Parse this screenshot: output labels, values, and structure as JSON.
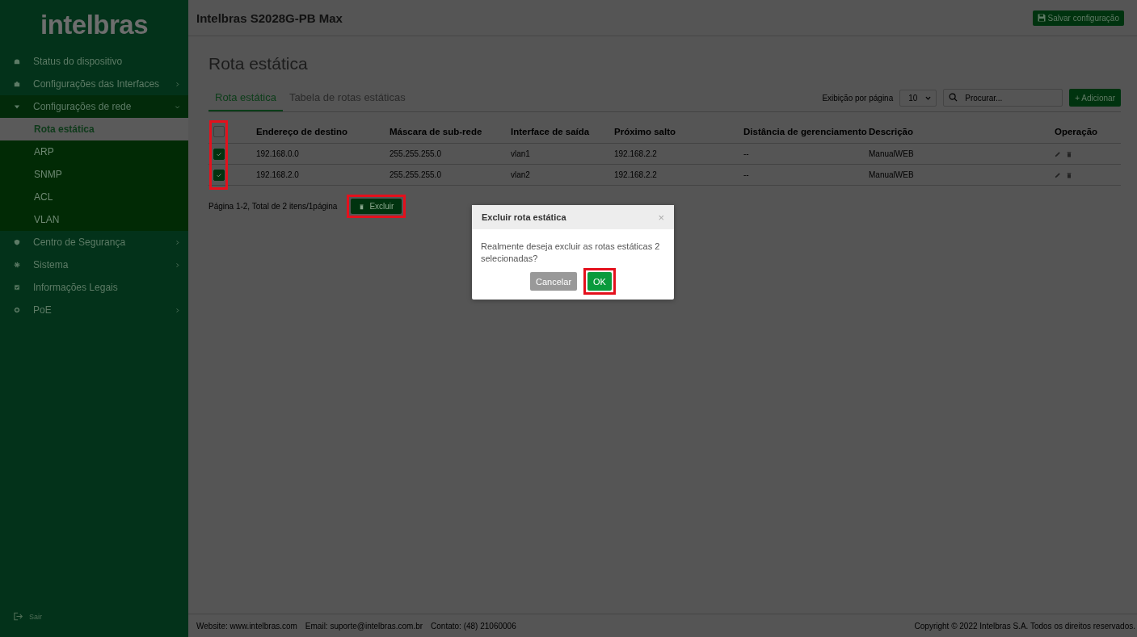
{
  "sidebar": {
    "logo": "intelbras",
    "items": [
      {
        "label": "Status do dispositivo",
        "kind": "home",
        "has_arrow": false,
        "expanded": false
      },
      {
        "label": "Configurações das Interfaces",
        "kind": "briefcase",
        "has_arrow": true,
        "expanded": false
      },
      {
        "label": "Configurações de rede",
        "kind": "caret",
        "has_arrow": true,
        "expanded": true,
        "children": [
          {
            "label": "Rota estática",
            "selected": true
          },
          {
            "label": "ARP",
            "selected": false
          },
          {
            "label": "SNMP",
            "selected": false
          },
          {
            "label": "ACL",
            "selected": false
          },
          {
            "label": "VLAN",
            "selected": false
          }
        ]
      },
      {
        "label": "Centro de Segurança",
        "kind": "shield",
        "has_arrow": true,
        "expanded": false
      },
      {
        "label": "Sistema",
        "kind": "gear",
        "has_arrow": true,
        "expanded": false
      },
      {
        "label": "Informações Legais",
        "kind": "check",
        "has_arrow": false,
        "expanded": false
      },
      {
        "label": "PoE",
        "kind": "plus",
        "has_arrow": true,
        "expanded": false
      }
    ],
    "logout": "Sair"
  },
  "header": {
    "device": "Intelbras S2028G-PB Max",
    "save_button": "Salvar configuração"
  },
  "page_title": "Rota estática",
  "tabs": [
    {
      "label": "Rota estática",
      "selected": true
    },
    {
      "label": "Tabela de rotas estáticas",
      "selected": false
    }
  ],
  "toolbar": {
    "per_page_label": "Exibição por página",
    "per_page": "10",
    "search_placeholder": "Procurar...",
    "add_button": "+ Adicionar"
  },
  "table": {
    "checkbox_column_highlighted": true,
    "header_checked": false,
    "columns": [
      "Endereço de destino",
      "Máscara de sub-rede",
      "Interface de saída",
      "Próximo salto",
      "Distância de gerenciamento",
      "Descrição",
      "Operação"
    ],
    "rows": [
      {
        "checked": true,
        "cells": [
          "192.168.0.0",
          "255.255.255.0",
          "vlan1",
          "192.168.2.2",
          "--",
          "ManualWEB"
        ]
      },
      {
        "checked": true,
        "cells": [
          "192.168.2.0",
          "255.255.255.0",
          "vlan2",
          "192.168.2.2",
          "--",
          "ManualWEB"
        ]
      }
    ]
  },
  "pagination": {
    "text": "Página 1-2, Total de 2 itens/1página",
    "delete_button": "Excluir",
    "delete_highlighted": true
  },
  "dialog": {
    "title": "Excluir rota estática",
    "close": "×",
    "message": "Realmente deseja excluir as rotas estáticas 2 selecionadas?",
    "cancel": "Cancelar",
    "ok": "OK",
    "ok_highlighted": true
  },
  "footer": {
    "website": "Website: www.intelbras.com",
    "email": "Email: suporte@intelbras.com.br",
    "contact": "Contato: (48) 21060006",
    "copyright": "Copyright © 2022 Intelbras S.A. Todos os direitos reservados."
  }
}
